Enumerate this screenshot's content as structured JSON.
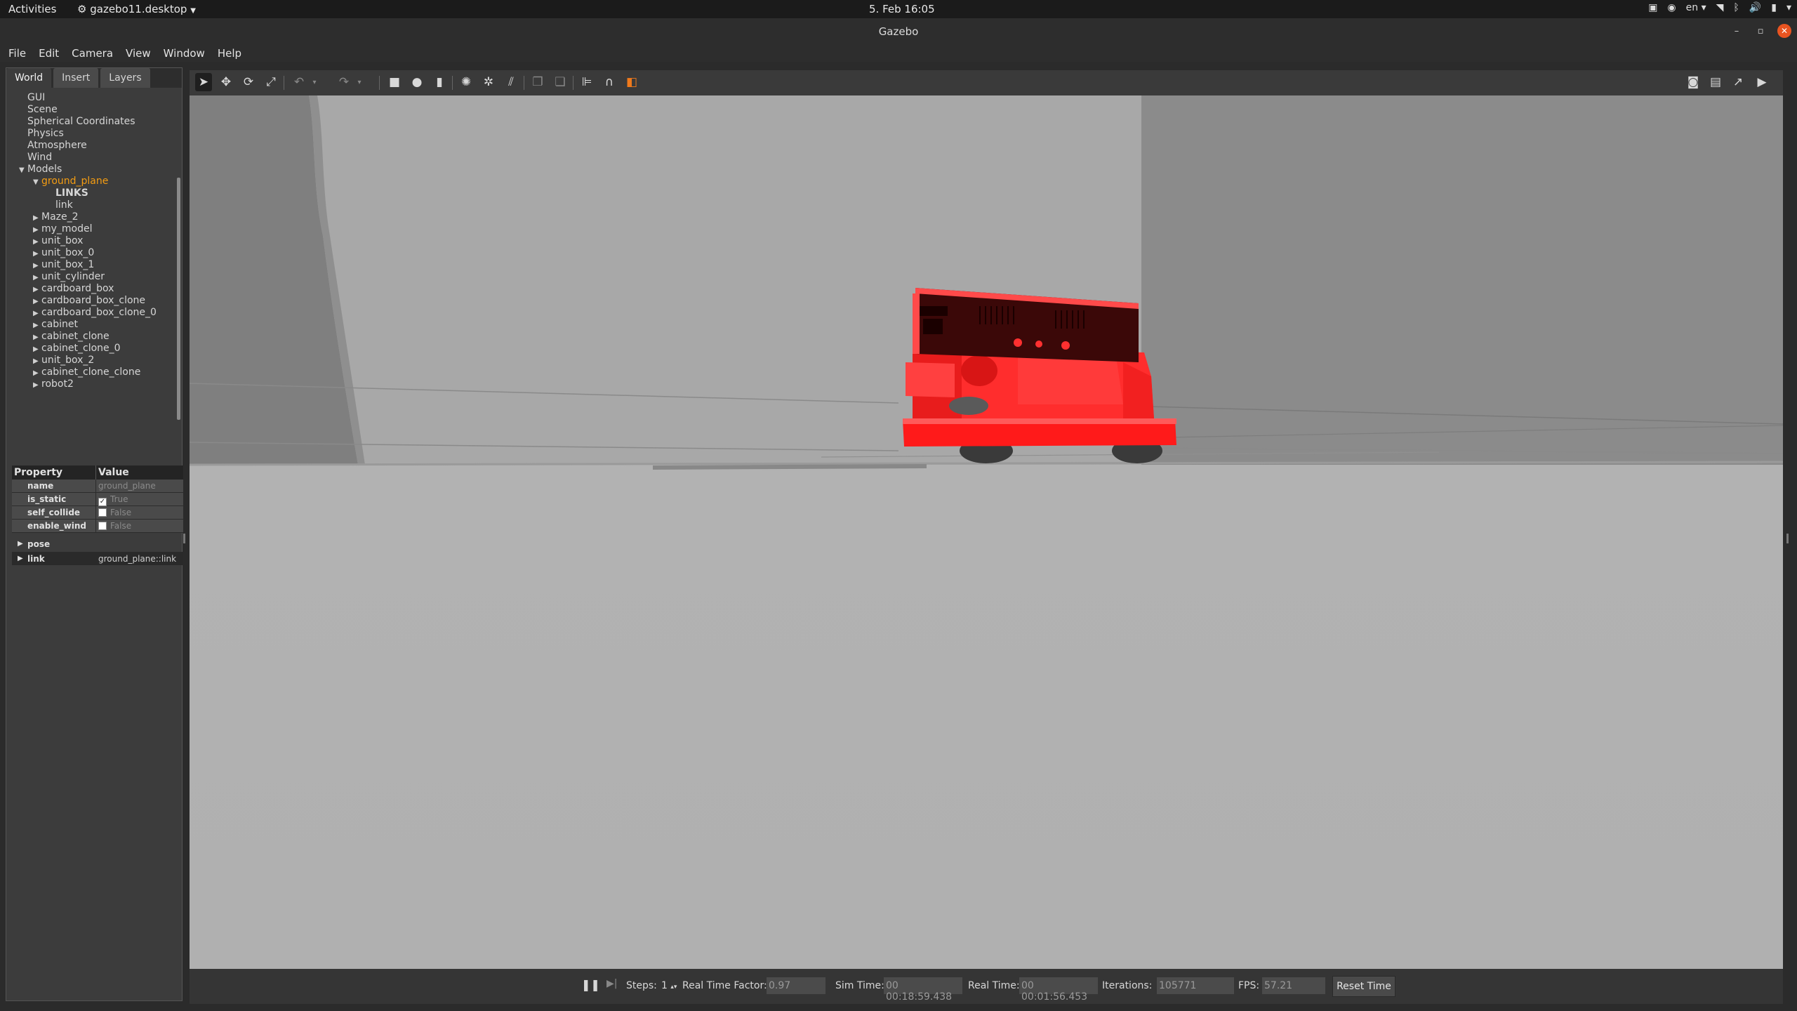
{
  "topbar": {
    "activities": "Activities",
    "app_name": "gazebo11.desktop",
    "clock": "5. Feb  16:05",
    "lang": "en"
  },
  "window": {
    "title": "Gazebo"
  },
  "menu": [
    "File",
    "Edit",
    "Camera",
    "View",
    "Window",
    "Help"
  ],
  "left_panel": {
    "tabs": [
      "World",
      "Insert",
      "Layers"
    ],
    "active_tab": "World",
    "tree": {
      "top": [
        "GUI",
        "Scene",
        "Spherical Coordinates",
        "Physics",
        "Atmosphere",
        "Wind"
      ],
      "models_label": "Models",
      "selected_model": "ground_plane",
      "links_label": "LINKS",
      "link_label": "link",
      "models": [
        "Maze_2",
        "my_model",
        "unit_box",
        "unit_box_0",
        "unit_box_1",
        "unit_cylinder",
        "cardboard_box",
        "cardboard_box_clone",
        "cardboard_box_clone_0",
        "cabinet",
        "cabinet_clone",
        "cabinet_clone_0",
        "unit_box_2",
        "cabinet_clone_clone",
        "robot2"
      ]
    },
    "properties": {
      "header_property": "Property",
      "header_value": "Value",
      "rows": [
        {
          "name": "name",
          "value": "ground_plane",
          "check": ""
        },
        {
          "name": "is_static",
          "value": "True",
          "check": "✓"
        },
        {
          "name": "self_collide",
          "value": "False",
          "check": ""
        },
        {
          "name": "enable_wind",
          "value": "False",
          "check": ""
        }
      ],
      "pose_label": "pose",
      "link_label": "link",
      "link_value": "ground_plane::link"
    }
  },
  "bottom_bar": {
    "steps_label": "Steps:",
    "steps_value": "1",
    "rtf_label": "Real Time Factor:",
    "rtf_value": "0.97",
    "sim_time_label": "Sim Time:",
    "sim_time_value": "00 00:18:59.438",
    "real_time_label": "Real Time:",
    "real_time_value": "00 00:01:56.453",
    "iterations_label": "Iterations:",
    "iterations_value": "105771",
    "fps_label": "FPS:",
    "fps_value": "57.21",
    "reset_label": "Reset Time"
  },
  "colors": {
    "accent_selected": "#f39c12",
    "robot": "#ff2a2a",
    "close_button": "#e95420"
  }
}
